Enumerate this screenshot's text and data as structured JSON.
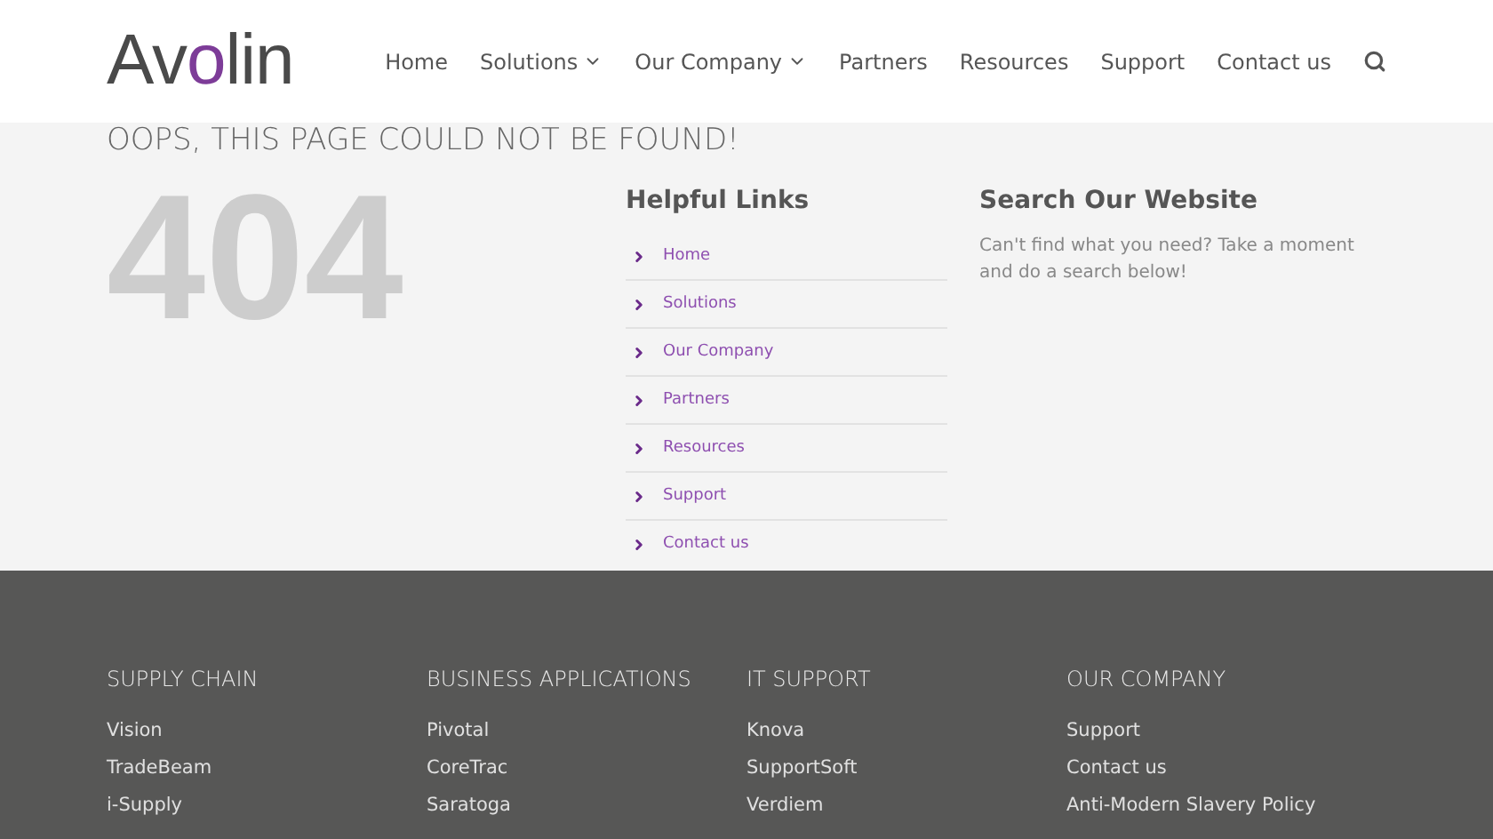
{
  "header": {
    "logo": "Avolin",
    "nav": [
      {
        "label": "Home",
        "dropdown": false
      },
      {
        "label": "Solutions",
        "dropdown": true
      },
      {
        "label": "Our Company",
        "dropdown": true
      },
      {
        "label": "Partners",
        "dropdown": false
      },
      {
        "label": "Resources",
        "dropdown": false
      },
      {
        "label": "Support",
        "dropdown": false
      },
      {
        "label": "Contact us",
        "dropdown": false
      }
    ]
  },
  "error": {
    "title": "OOPS, THIS PAGE COULD NOT BE FOUND!",
    "code": "404"
  },
  "helpful_links": {
    "heading": "Helpful Links",
    "items": [
      "Home",
      "Solutions",
      "Our Company",
      "Partners",
      "Resources",
      "Support",
      "Contact us"
    ]
  },
  "search": {
    "heading": "Search Our Website",
    "text": "Can't find what you need? Take a moment and do a search below!"
  },
  "footer": [
    {
      "heading": "SUPPLY CHAIN",
      "links": [
        "Vision",
        "TradeBeam",
        "i-Supply"
      ]
    },
    {
      "heading": "BUSINESS APPLICATIONS",
      "links": [
        "Pivotal",
        "CoreTrac",
        "Saratoga"
      ]
    },
    {
      "heading": "IT SUPPORT",
      "links": [
        "Knova",
        "SupportSoft",
        "Verdiem"
      ]
    },
    {
      "heading": "OUR COMPANY",
      "links": [
        "Support",
        "Contact us",
        "Anti-Modern Slavery Policy"
      ]
    }
  ]
}
